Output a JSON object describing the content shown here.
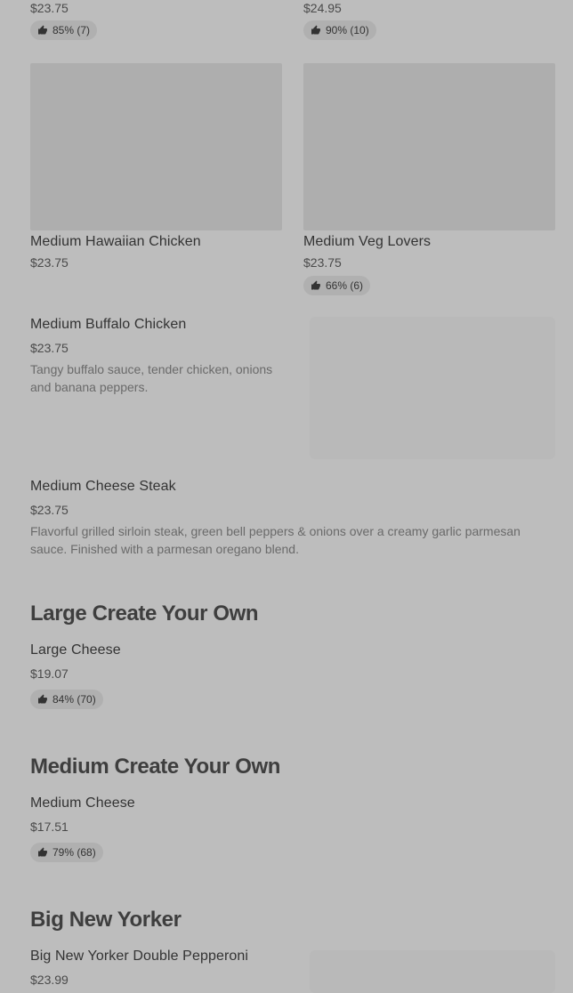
{
  "top_row": [
    {
      "price": "$23.75",
      "rating": "85% (7)"
    },
    {
      "price": "$24.95",
      "rating": "90% (10)"
    }
  ],
  "grid_items": [
    {
      "title": "Medium Hawaiian Chicken",
      "price": "$23.75"
    },
    {
      "title": "Medium Veg Lovers",
      "price": "$23.75",
      "rating": "66% (6)"
    }
  ],
  "list_items": [
    {
      "title": "Medium Buffalo Chicken",
      "price": "$23.75",
      "description": "Tangy buffalo sauce, tender chicken, onions and banana peppers."
    },
    {
      "title": "Medium Cheese Steak",
      "price": "$23.75",
      "description": "Flavorful grilled sirloin steak, green bell peppers & onions over a creamy garlic parmesan sauce. Finished with a parmesan oregano blend."
    }
  ],
  "sections": [
    {
      "heading": "Large Create Your Own",
      "item": {
        "title": "Large Cheese",
        "price": "$19.07",
        "rating": "84% (70)"
      }
    },
    {
      "heading": "Medium Create Your Own",
      "item": {
        "title": "Medium Cheese",
        "price": "$17.51",
        "rating": "79% (68)"
      }
    },
    {
      "heading": "Big New Yorker",
      "item": {
        "title": "Big New Yorker Double Pepperoni",
        "price": "$23.99"
      }
    }
  ],
  "icons": {
    "rating": "thumbs-up-icon"
  }
}
